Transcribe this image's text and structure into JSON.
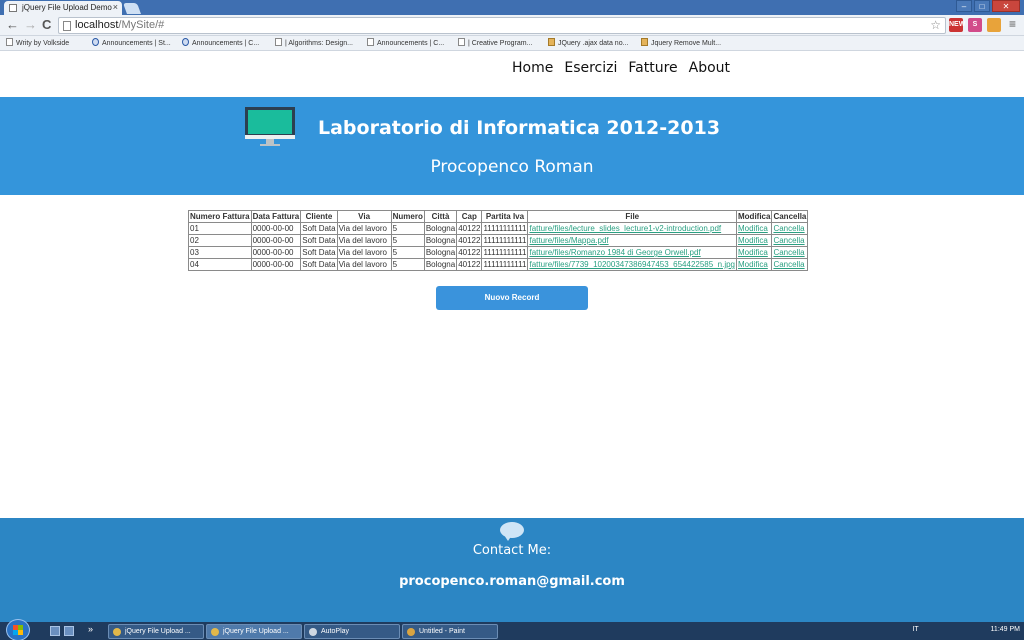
{
  "browser": {
    "tab_title": "jQuery File Upload Demo",
    "tab_close": "×",
    "url_host": "localhost",
    "url_path": "/MySite/#",
    "back": "←",
    "forward": "→",
    "reload": "C",
    "star": "☆",
    "menu": "≡",
    "win_min": "–",
    "win_max": "□",
    "win_close": "✕",
    "ext_new": "NEW",
    "ext_s": "S",
    "bookmarks": [
      "Writy by Volkside",
      "Announcements | St...",
      "Announcements | C...",
      "| Algorithms: Design...",
      "Announcements | C...",
      "| Creative Program...",
      "JQuery .ajax data no...",
      "Jquery Remove Mult..."
    ]
  },
  "nav": {
    "items": [
      "Home",
      "Esercizi",
      "Fatture",
      "About"
    ]
  },
  "hero": {
    "title": "Laboratorio di Informatica 2012-2013",
    "subtitle": "Procopenco Roman"
  },
  "table": {
    "headers": [
      "Numero Fattura",
      "Data Fattura",
      "Cliente",
      "Via",
      "Numero",
      "Città",
      "Cap",
      "Partita Iva",
      "File",
      "Modifica",
      "Cancella"
    ],
    "rows": [
      [
        "01",
        "0000-00-00",
        "Soft Data",
        "Via del lavoro",
        "5",
        "Bologna",
        "40122",
        "11111111111",
        "fatture/files/lecture_slides_lecture1-v2-introduction.pdf",
        "Modifica",
        "Cancella"
      ],
      [
        "02",
        "0000-00-00",
        "Soft Data",
        "Via del lavoro",
        "5",
        "Bologna",
        "40122",
        "11111111111",
        "fatture/files/Mappa.pdf",
        "Modifica",
        "Cancella"
      ],
      [
        "03",
        "0000-00-00",
        "Soft Data",
        "Via del lavoro",
        "5",
        "Bologna",
        "40122",
        "11111111111",
        "fatture/files/Romanzo 1984 di George Orwell.pdf",
        "Modifica",
        "Cancella"
      ],
      [
        "04",
        "0000-00-00",
        "Soft Data",
        "Via del lavoro",
        "5",
        "Bologna",
        "40122",
        "11111111111",
        "fatture/files/7739_10200347386947453_654422585_n.jpg",
        "Modifica",
        "Cancella"
      ]
    ]
  },
  "new_record_label": "Nuovo Record",
  "footer": {
    "contact_label": "Contact Me:",
    "email": "procopenco.roman@gmail.com"
  },
  "taskbar": {
    "items": [
      "jQuery File Upload ...",
      "jQuery File Upload ...",
      "AutoPlay",
      "Untitled - Paint"
    ],
    "chevron": "»",
    "lang": "IT",
    "time": "11:49 PM"
  },
  "colors": {
    "hero_bg": "#3495db",
    "footer_bg": "#2c86c4",
    "button_bg": "#3a93dc",
    "link": "#2aa082"
  }
}
